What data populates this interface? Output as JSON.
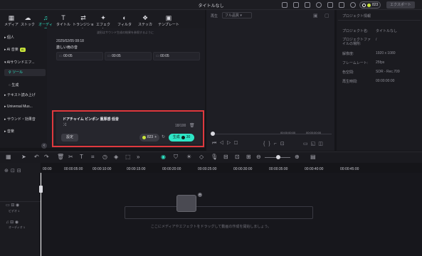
{
  "window": {
    "title": "タイトルなし",
    "credits": "823",
    "export_label": "エクスポート"
  },
  "toolbar": {
    "tabs": [
      {
        "label": "メディア",
        "icon": "media-icon"
      },
      {
        "label": "ストック",
        "icon": "stock-icon"
      },
      {
        "label": "オーディオ",
        "icon": "audio-icon",
        "active": true
      },
      {
        "label": "タイトル",
        "icon": "title-icon"
      },
      {
        "label": "トランジション",
        "icon": "transition-icon"
      },
      {
        "label": "エフェクト",
        "icon": "effect-icon"
      },
      {
        "label": "フィルター",
        "icon": "filter-icon"
      },
      {
        "label": "ステッカー",
        "icon": "sticker-icon"
      },
      {
        "label": "テンプレート",
        "icon": "template-icon"
      }
    ]
  },
  "sidebar": {
    "items": [
      {
        "label": "個人"
      },
      {
        "label": "AI 音楽",
        "badge": "AI"
      },
      {
        "label": "AIサウンドエフ..."
      },
      {
        "label": "ツール",
        "active": true
      },
      {
        "label": "生成"
      },
      {
        "label": "テキスト読み上げ"
      },
      {
        "label": "Universal Mus..."
      },
      {
        "label": "サウンド・効果音"
      },
      {
        "label": "音楽"
      }
    ]
  },
  "content": {
    "note": "波形はサウンド生成の結果を参照するように",
    "date": "2025/02/05 08:18",
    "item_title": "激しい雨の音",
    "durations": [
      "00:05",
      "00:05",
      "00:05"
    ]
  },
  "prompt_panel": {
    "text": "ドアチャイム ピンポン 重厚感 低音",
    "counter": "18/100",
    "settings_label": "設定",
    "credits": "823",
    "generate_label": "生成",
    "generate_cost": "30"
  },
  "preview": {
    "label": "再生",
    "quality": "フル品質",
    "time_current": "00:00:00:00",
    "time_total": "00:00:00:00"
  },
  "properties": {
    "header": "プロジェクト情報",
    "rows": [
      {
        "k": "プロジェクト名:",
        "v": "タイトルなし"
      },
      {
        "k": "プロジェクトファイルの場所:",
        "v": "/"
      },
      {
        "k": "解像度:",
        "v": "1920 x 1080"
      },
      {
        "k": "フレームレート:",
        "v": "25fps"
      },
      {
        "k": "色空間:",
        "v": "SDR - Rec.709"
      },
      {
        "k": "再生時間:",
        "v": "00:00:00:00"
      }
    ]
  },
  "timeline": {
    "ticks": [
      "00:00",
      "00:00:05:00",
      "00:00:10:00",
      "00:00:15:00",
      "00:00:20:00",
      "00:00:25:00",
      "00:00:30:00",
      "00:00:35:00",
      "00:00:40:00",
      "00:00:45:00"
    ],
    "tracks": [
      {
        "label": "ビデオ 1"
      },
      {
        "label": "オーディオ 1"
      }
    ],
    "hint": "ここにメディアやエフェクトをドラッグして動画の作成を開始しましょう。"
  },
  "colors": {
    "accent": "#2ee6c6",
    "highlight": "#e0393e",
    "badge": "#c9e53a"
  }
}
